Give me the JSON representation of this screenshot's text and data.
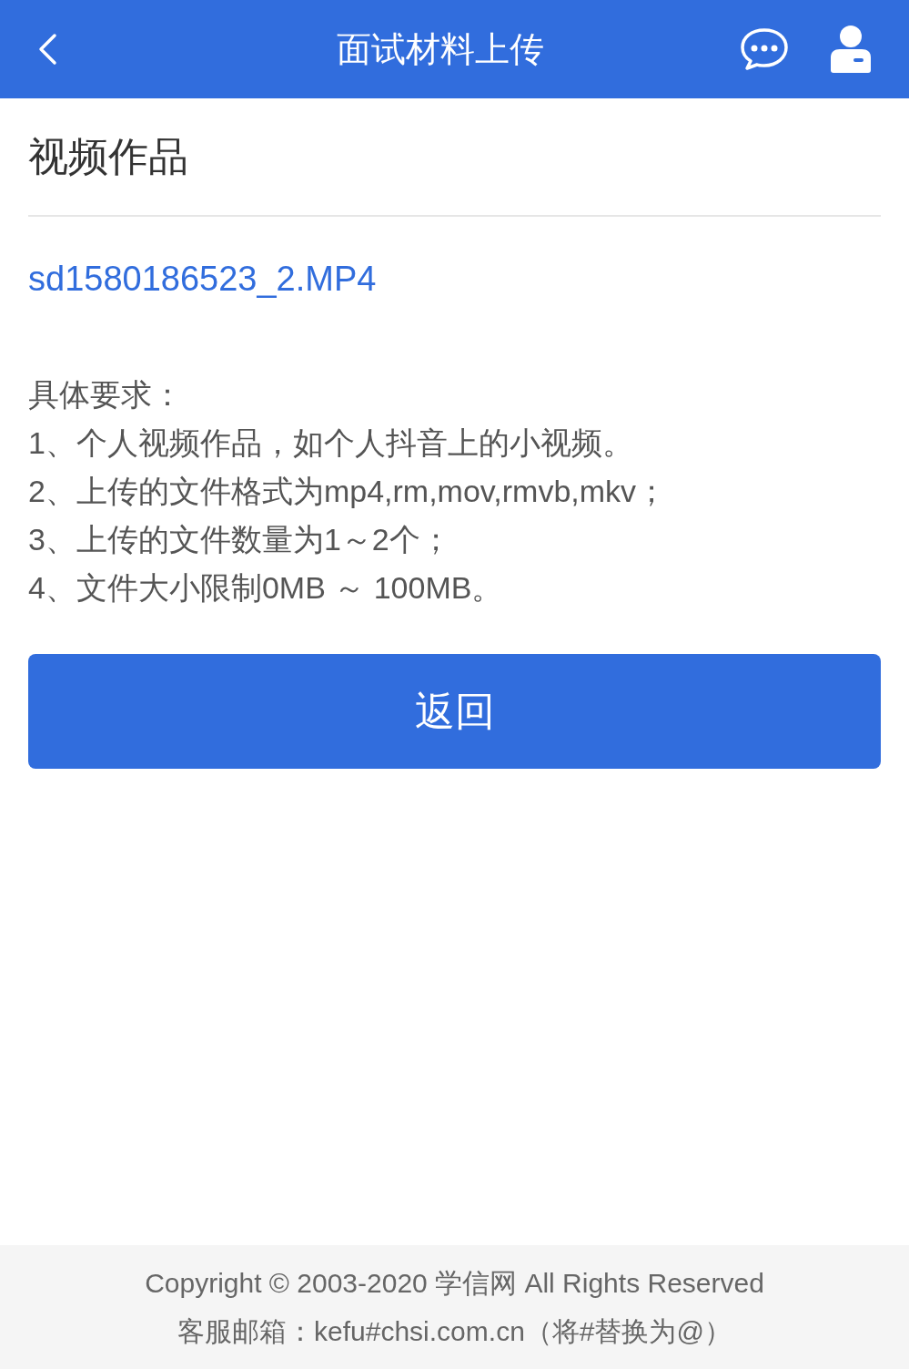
{
  "header": {
    "title": "面试材料上传"
  },
  "section": {
    "title": "视频作品"
  },
  "file": {
    "name": "sd1580186523_2.MP4"
  },
  "requirements": {
    "heading": "具体要求：",
    "items": [
      "1、个人视频作品，如个人抖音上的小视频。",
      "2、上传的文件格式为mp4,rm,mov,rmvb,mkv；",
      "3、上传的文件数量为1～2个；",
      "4、文件大小限制0MB ～ 100MB。"
    ]
  },
  "button": {
    "label": "返回"
  },
  "footer": {
    "copyright": "Copyright © 2003-2020 学信网 All Rights Reserved",
    "contact": "客服邮箱：kefu#chsi.com.cn（将#替换为@）"
  }
}
